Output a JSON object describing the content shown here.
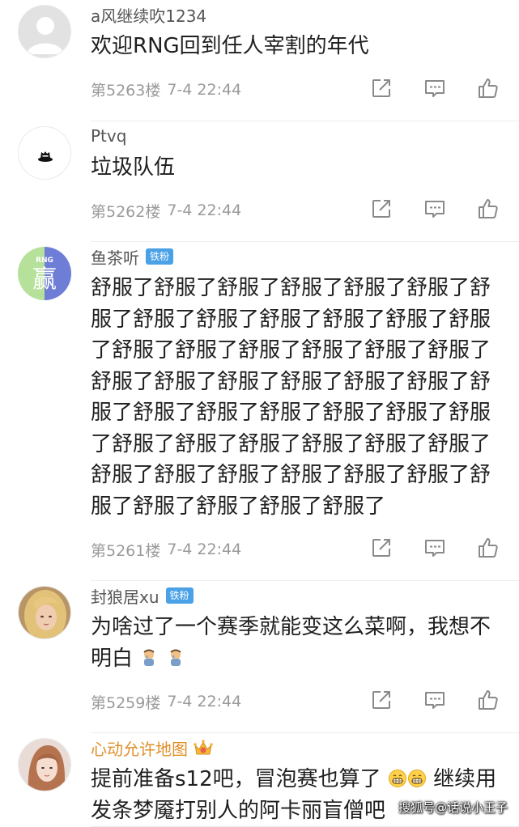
{
  "comments": [
    {
      "username": "a风继续吹1234",
      "text": "欢迎RNG回到任人宰割的年代",
      "floor": "第5263楼",
      "time": "7-4 22:44",
      "avatar": "default-avatar"
    },
    {
      "username": "Ptvq",
      "text": "垃圾队伍",
      "floor": "第5262楼",
      "time": "7-4 22:44",
      "avatar": "black-hat-avatar"
    },
    {
      "username": "鱼茶听",
      "badge": "铁粉",
      "text": "舒服了舒服了舒服了舒服了舒服了舒服了舒服了舒服了舒服了舒服了舒服了舒服了舒服了舒服了舒服了舒服了舒服了舒服了舒服了舒服了舒服了舒服了舒服了舒服了舒服了舒服了舒服了舒服了舒服了舒服了舒服了舒服了舒服了舒服了舒服了舒服了舒服了舒服了舒服了舒服了舒服了舒服了舒服了舒服了舒服了舒服了舒服了舒服了舒服了",
      "floor": "第5261楼",
      "time": "7-4 22:44",
      "avatar_text_top": "RNG",
      "avatar_text_main": "赢"
    },
    {
      "username": "封狼居xu",
      "badge": "铁粉",
      "text": "为啥过了一个赛季就能变这么菜啊，我想不明白",
      "floor": "第5259楼",
      "time": "7-4 22:44",
      "avatar": "blonde-girl-avatar"
    },
    {
      "username": "心动允许地图",
      "text_before": "提前准备s12吧，冒泡赛也算了",
      "text_after": "继续用发条梦魇打别人的阿卡丽盲僧吧",
      "avatar": "girl-photo-avatar"
    }
  ],
  "watermark": "搜狐号@话说小王子",
  "colors": {
    "badge": "#4aa1e6",
    "gold_username": "#e08f2a",
    "meta_text": "#9a9a9a",
    "icon": "#8a8a8a"
  },
  "icons": [
    "share-icon",
    "comment-icon",
    "like-icon"
  ]
}
